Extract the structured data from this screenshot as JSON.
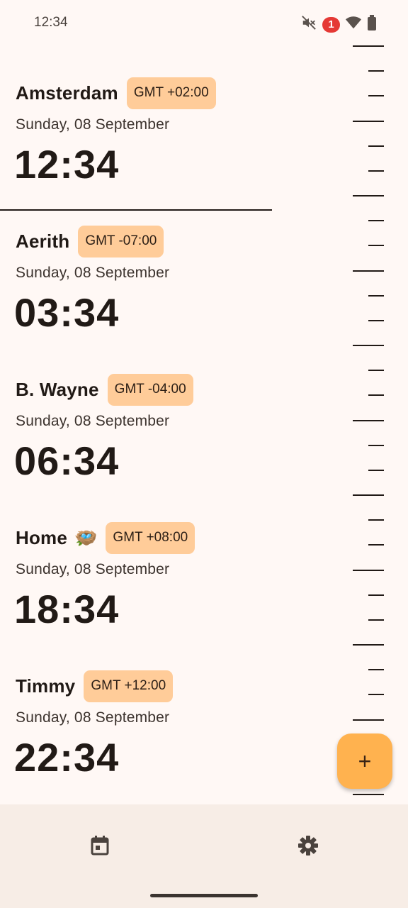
{
  "status_bar": {
    "time": "12:34",
    "notification_count": "1",
    "icons": [
      "mute-icon",
      "notification-badge",
      "wifi-icon",
      "battery-icon"
    ]
  },
  "zones": [
    {
      "name": "Amsterdam",
      "offset": "GMT +02:00",
      "date": "Sunday, 08 September",
      "time": "12:34"
    },
    {
      "name": "Aerith",
      "offset": "GMT -07:00",
      "date": "Sunday, 08 September",
      "time": "03:34"
    },
    {
      "name": "B. Wayne",
      "offset": "GMT -04:00",
      "date": "Sunday, 08 September",
      "time": "06:34"
    },
    {
      "name": "Home",
      "offset": "GMT +08:00",
      "date": "Sunday, 08 September",
      "time": "18:34",
      "icon": "🪺"
    },
    {
      "name": "Timmy",
      "offset": "GMT +12:00",
      "date": "Sunday, 08 September",
      "time": "22:34"
    }
  ],
  "fab": {
    "label": "+",
    "icon": "plus-icon"
  },
  "bottom_nav": {
    "items": [
      "calendar-icon",
      "settings-icon"
    ]
  },
  "colors": {
    "background": "#fff8f5",
    "chip": "#ffcc99",
    "fab": "#ffb24f",
    "nav_background": "#f7ede6",
    "text": "#211a16",
    "badge": "#e53935"
  }
}
